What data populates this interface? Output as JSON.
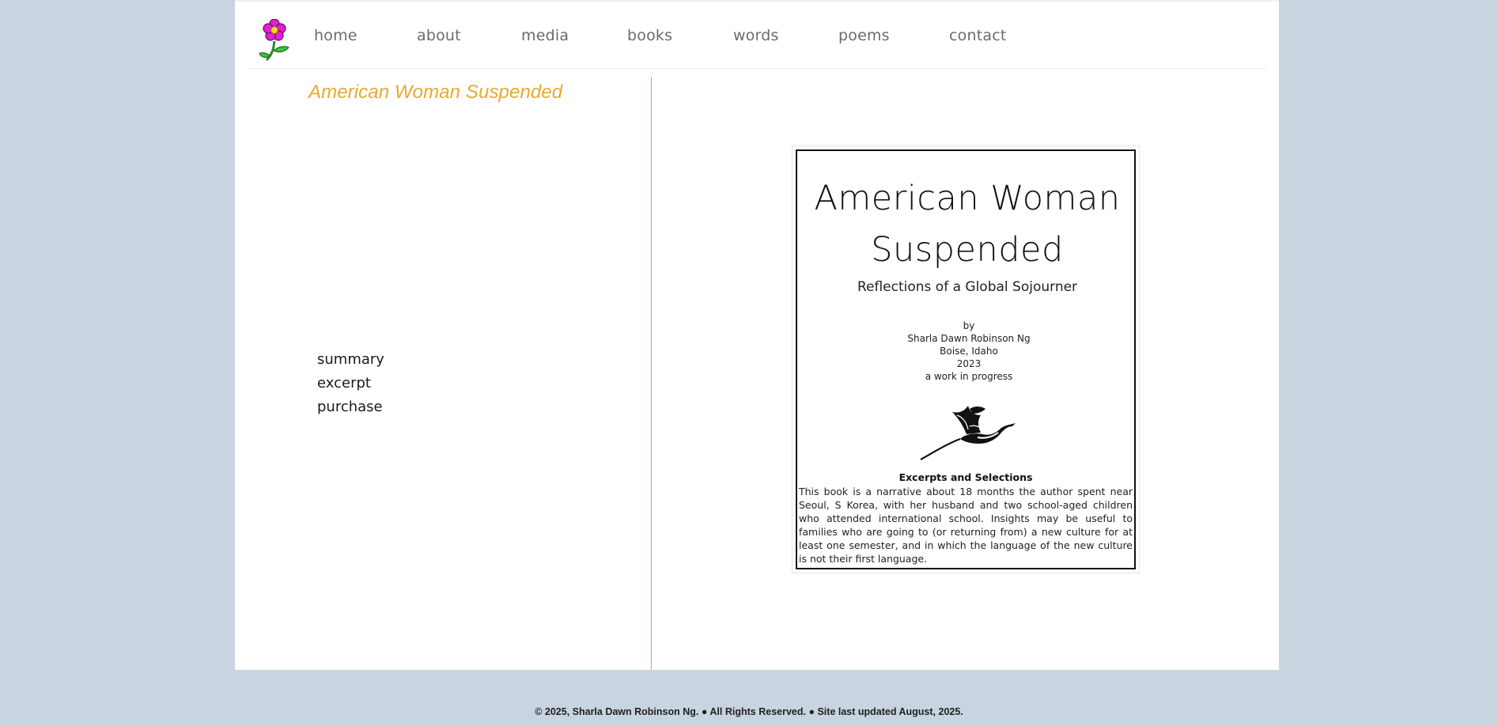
{
  "nav": {
    "items": [
      {
        "label": "home"
      },
      {
        "label": "about"
      },
      {
        "label": "media"
      },
      {
        "label": "books"
      },
      {
        "label": "words"
      },
      {
        "label": "poems"
      },
      {
        "label": "contact"
      }
    ]
  },
  "book": {
    "title": "American Woman Suspended",
    "links": [
      {
        "label": "summary"
      },
      {
        "label": "excerpt"
      },
      {
        "label": "purchase"
      }
    ]
  },
  "cover": {
    "title_line1": "American Woman",
    "title_line2": "Suspended",
    "subtitle": "Reflections of a Global Sojourner",
    "by": "by",
    "author": "Sharla Dawn Robinson Ng",
    "place": "Boise, Idaho",
    "year": "2023",
    "status": "a work in progress",
    "heading": "Excerpts and Selections",
    "blurb": "This book is a narrative about 18 months the author spent near Seoul, S Korea, with her husband and two school-aged children who attended international school.  Insights may be useful to families who are going to (or returning from) a new culture for at least one semester, and in which the language of the new culture is not their first language."
  },
  "footer": {
    "text": "© 2025, Sharla Dawn Robinson Ng. ● All Rights Reserved. ● Site last updated August, 2025."
  },
  "colors": {
    "background": "#c8d4e0",
    "title_accent": "#e8a92e",
    "divider": "#c98fd6",
    "nav_text": "#6b6b6b"
  },
  "icons": {
    "logo": "flower-icon",
    "cover_art": "magpie-bird-icon"
  }
}
